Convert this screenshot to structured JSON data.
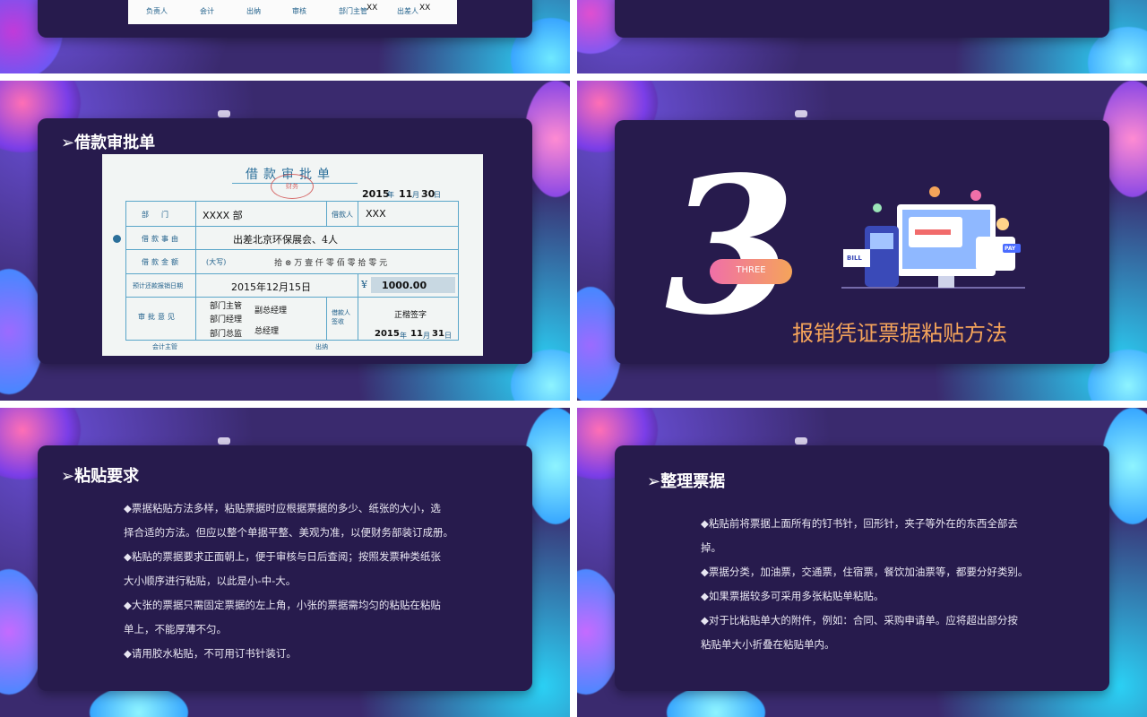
{
  "slides": {
    "top_left": {
      "form_footer": {
        "responsible": "负责人",
        "accountant": "会计",
        "cashier": "出纳",
        "review": "审核",
        "dept_head": "部门主管",
        "dept_head_value": "XX",
        "claimant": "出差人",
        "claimant_value": "XX"
      }
    },
    "loan": {
      "heading": "➢借款审批单",
      "form": {
        "title": "借款审批单",
        "date": {
          "year": "2015",
          "month": "11",
          "day": "30",
          "year_unit": "年",
          "month_unit": "月",
          "day_unit": "日"
        },
        "dept_label": "部门",
        "dept_value": "XXXX 部",
        "borrower_label": "借款人",
        "borrower_value": "XXX",
        "reason_label": "借款事由",
        "reason_value": "出差北京环保展会、4人",
        "amount_label": "借款金额",
        "amount_upper": "(大写)",
        "amount_words": "拾 ⊗  万 壹 仟  零 佰  零 拾  零 元",
        "repay_label": "预计还款报销日期",
        "repay_value": "2015年12月15日",
        "amount_symbol": "¥",
        "amount_value": "1000.00",
        "approval_label": "审批意见",
        "approvers": [
          "部门主管",
          "部门经理",
          "部门总监"
        ],
        "approver_notes": [
          "副总经理",
          "总经理"
        ],
        "sign_label": "借款人签收",
        "sign_value": "正楷签字",
        "sign_date": {
          "year": "2015",
          "month": "11",
          "day": "31",
          "year_unit": "年",
          "month_unit": "月",
          "day_unit": "日"
        },
        "footer_accountant": "会计主管",
        "footer_cashier": "出纳",
        "stamp": "财务"
      }
    },
    "section3": {
      "number": "3",
      "label": "THREE",
      "title": "报销凭证票据粘贴方法",
      "illustration_words": {
        "bill": "BILL",
        "pay": "PAY"
      }
    },
    "paste": {
      "heading": "➢粘贴要求",
      "lines": [
        "◆票据粘贴方法多样，粘贴票据时应根据票据的多少、纸张的大小，选",
        "择合适的方法。但应以整个单据平整、美观为准，以便财务部装订成册。",
        "◆粘贴的票据要求正面朝上，便于审核与日后查阅；按照发票种类纸张",
        "大小顺序进行粘贴，以此是小-中-大。",
        "◆大张的票据只需固定票据的左上角，小张的票据需均匀的粘贴在粘贴",
        "单上，不能厚薄不匀。",
        "◆请用胶水粘贴，不可用订书针装订。"
      ]
    },
    "organize": {
      "heading": "➢整理票据",
      "lines": [
        "◆粘贴前将票据上面所有的钉书针，回形针，夹子等外在的东西全部去",
        "掉。",
        "◆票据分类，加油票，交通票，住宿票，餐饮加油票等，都要分好类别。",
        "◆如果票据较多可采用多张粘贴单粘贴。",
        "◆对于比粘贴单大的附件，例如：合同、采购申请单。应将超出部分按",
        "粘贴单大小折叠在粘贴单内。"
      ]
    }
  },
  "colors": {
    "slide_bg": "#3a2a6e",
    "panel_bg": "#271b4d",
    "accent_orange": "#f5a45a",
    "accent_pink": "#f06fa8",
    "blob_cyan": "#2bd1f5",
    "blob_purple": "#8a4fe8"
  }
}
